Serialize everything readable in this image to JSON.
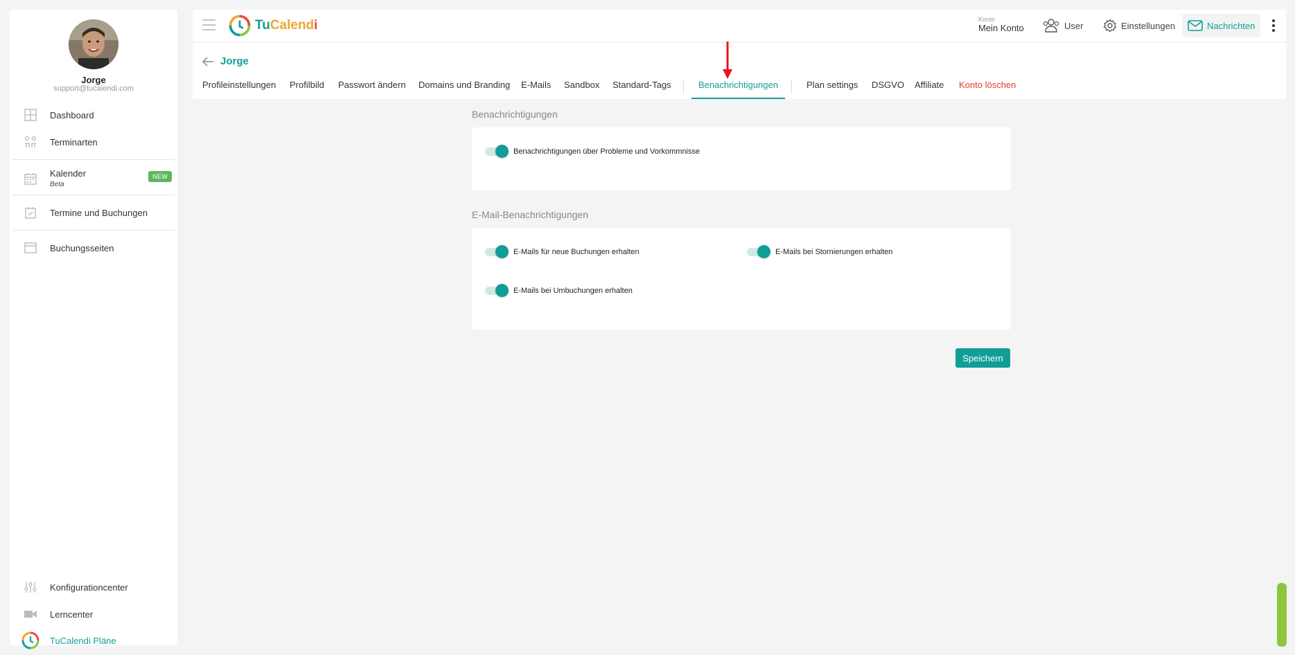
{
  "sidebar": {
    "user_name": "Jorge",
    "user_email": "support@tucalendi.com",
    "items": [
      {
        "label": "Dashboard",
        "icon": "dashboard-icon"
      },
      {
        "label": "Terminarten",
        "icon": "event-types-icon"
      },
      {
        "label": "Kalender",
        "sub": "Beta",
        "badge": "NEW",
        "icon": "calendar-icon"
      },
      {
        "label": "Termine und Buchungen",
        "icon": "calendar-check-icon"
      },
      {
        "label": "Buchungsseiten",
        "icon": "window-icon"
      }
    ],
    "bottom_items": [
      {
        "label": "Konfigurationcenter",
        "icon": "sliders-icon"
      },
      {
        "label": "Lerncenter",
        "icon": "video-icon"
      },
      {
        "label": "TuCalendi Pläne",
        "icon": "tucalendi-logo-icon"
      }
    ]
  },
  "topbar": {
    "logo_parts": [
      "Tu",
      "Calend",
      "i"
    ],
    "konto_small": "Konto",
    "konto_big": "Mein Konto",
    "user_label": "User",
    "settings_label": "Einstellungen",
    "messages_label": "Nachrichten"
  },
  "profile": {
    "name": "Jorge",
    "tabs": [
      {
        "label": "Profileinstellungen"
      },
      {
        "label": "Profilbild"
      },
      {
        "label": "Passwort ändern"
      },
      {
        "label": "Domains und Branding"
      },
      {
        "label": "E-Mails"
      },
      {
        "label": "Sandbox"
      },
      {
        "label": "Standard-Tags"
      },
      {
        "label": "Benachrichtigungen",
        "active": true
      },
      {
        "label": "Plan settings"
      },
      {
        "label": "DSGVO"
      },
      {
        "label": "Affiliate"
      },
      {
        "label": "Konto löschen",
        "danger": true
      }
    ]
  },
  "notifications": {
    "title": "Benachrichtigungen",
    "toggles": [
      {
        "label": "Benachrichtigungen über Probleme und Vorkommnisse",
        "on": true
      }
    ]
  },
  "email_notifications": {
    "title": "E-Mail-Benachrichtigungen",
    "toggles": [
      {
        "label": "E-Mails für neue Buchungen erhalten",
        "on": true
      },
      {
        "label": "E-Mails bei Stornierungen erhalten",
        "on": true
      },
      {
        "label": "E-Mails bei Umbuchungen erhalten",
        "on": true
      }
    ]
  },
  "actions": {
    "save_label": "Speichern"
  },
  "colors": {
    "accent": "#119e96",
    "danger": "#e53935",
    "badge": "#5cb85c",
    "logo_orange": "#f1a431",
    "annotation_arrow": "#e8141b"
  }
}
